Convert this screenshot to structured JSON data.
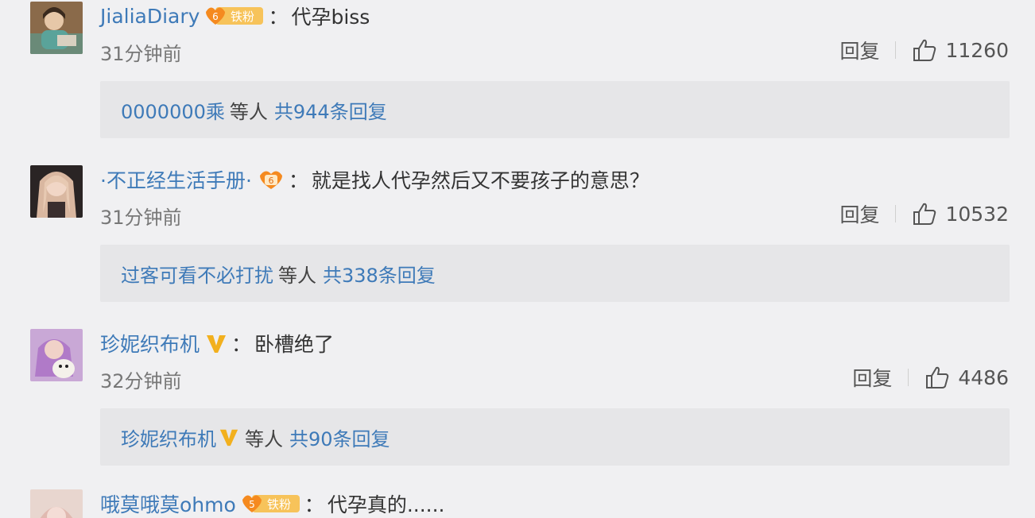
{
  "comments": [
    {
      "username": "JialiaDiary",
      "badge_text": "铁粉",
      "badge_level": "6",
      "text": "代孕biss",
      "time": "31分钟前",
      "reply_label": "回复",
      "likes": "11260",
      "replies": {
        "user": "0000000乘",
        "etc": "等人",
        "total": "共944条回复"
      }
    },
    {
      "username": "·不正经生活手册·",
      "badge_level": "6",
      "text": "就是找人代孕然后又不要孩子的意思？",
      "time": "31分钟前",
      "reply_label": "回复",
      "likes": "10532",
      "replies": {
        "user": "过客可看不必打扰",
        "etc": "等人",
        "total": "共338条回复"
      }
    },
    {
      "username": "珍妮织布机",
      "text": "卧槽绝了",
      "time": "32分钟前",
      "reply_label": "回复",
      "likes": "4486",
      "replies": {
        "user": "珍妮织布机",
        "etc": "等人",
        "total": "共90条回复"
      }
    },
    {
      "username": "哦莫哦莫ohmo",
      "badge_text": "铁粉",
      "badge_level": "5",
      "text": "代孕真的......"
    }
  ],
  "colors": {
    "link_blue": "#3e7ab8",
    "badge_orange": "#f5a623",
    "verified_gold": "#f2b01e"
  }
}
